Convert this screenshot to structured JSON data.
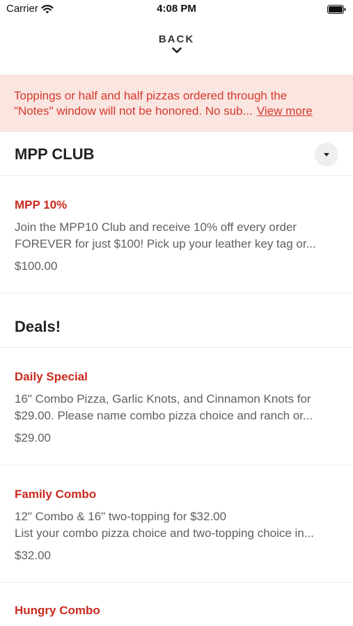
{
  "status_bar": {
    "carrier": "Carrier",
    "time": "4:08 PM"
  },
  "nav": {
    "back_label": "BACK"
  },
  "notice": {
    "text_line1": "Toppings or half and half pizzas ordered through the",
    "text_line2": "\"Notes\" window will not be honored. No sub...",
    "view_more": "View more"
  },
  "sections": [
    {
      "title": "MPP CLUB",
      "items": [
        {
          "name": "MPP 10%",
          "desc_line1": "Join the MPP10 Club and receive 10% off every order",
          "desc_line2": "FOREVER for just $100! Pick up your leather key tag or...",
          "price": "$100.00"
        }
      ]
    },
    {
      "title": "Deals!",
      "items": [
        {
          "name": "Daily Special",
          "desc_line1": "16\" Combo Pizza, Garlic Knots, and Cinnamon Knots for",
          "desc_line2": "$29.00.  Please name combo pizza choice and ranch or...",
          "price": "$29.00"
        },
        {
          "name": "Family Combo",
          "desc_line1": "12\" Combo & 16\" two-topping for $32.00",
          "desc_line2": "List your combo pizza choice and two-topping choice in...",
          "price": "$32.00"
        },
        {
          "name": "Hungry Combo"
        }
      ]
    }
  ],
  "colors": {
    "accent": "#c92a1e",
    "notice_bg": "#fbe5e1",
    "notice_text": "#d6392c"
  }
}
